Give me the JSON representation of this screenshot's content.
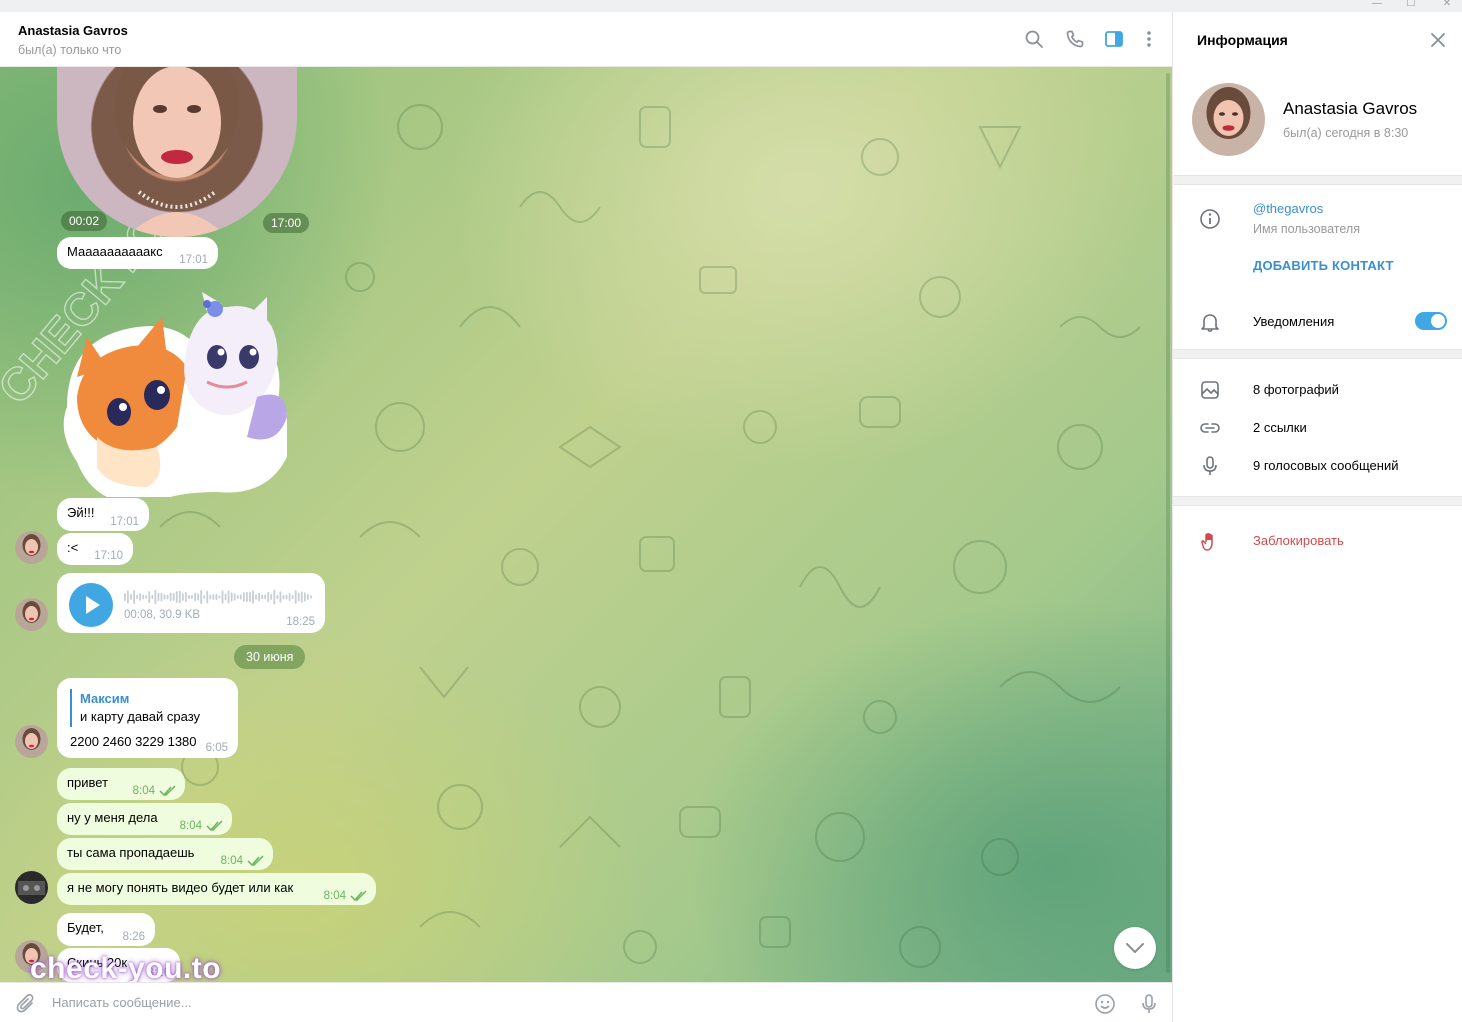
{
  "window": {
    "controls": [
      "—",
      "☐",
      "✕"
    ]
  },
  "header": {
    "peer_name": "Anastasia Gavros",
    "peer_status": "был(а) только что",
    "icons": [
      "search-icon",
      "phone-icon",
      "sidebar-toggle-icon",
      "more-vertical-icon"
    ]
  },
  "messages": {
    "video_note": {
      "duration": "00:02",
      "time": "17:00"
    },
    "msg1": {
      "text": "Маааааааааакс",
      "time": "17:01"
    },
    "msg2": {
      "text": "Эй!!!",
      "time": "17:01"
    },
    "msg3": {
      "text": ":<",
      "time": "17:10"
    },
    "voice": {
      "meta": "00:08, 30.9 KB",
      "time": "18:25",
      "progress": 0
    },
    "date_separator": "30 июня",
    "reply": {
      "author": "Максим",
      "quote": "и карту давай сразу",
      "text": "2200 2460 3229 1380",
      "time": "6:05"
    },
    "out1": {
      "text": "привет",
      "time": "8:04"
    },
    "out2": {
      "text": "ну у меня дела",
      "time": "8:04"
    },
    "out3": {
      "text": "ты сама пропадаешь",
      "time": "8:04"
    },
    "out4": {
      "text": "я не могу понять видео будет или как",
      "time": "8:04"
    },
    "msg4": {
      "text": "Будет,",
      "time": "8:26"
    },
    "msg5": {
      "text": "Скинь 20к",
      "time": "8:26"
    }
  },
  "watermarks": {
    "bottom": "check-you.to",
    "diagonal": "CHECKYOU.ME"
  },
  "composer": {
    "placeholder": "Написать сообщение..."
  },
  "info_panel": {
    "title": "Информация",
    "name": "Anastasia Gavros",
    "status": "был(а) сегодня в 8:30",
    "username": "@thegavros",
    "username_label": "Имя пользователя",
    "add_contact": "ДОБАВИТЬ КОНТАКТ",
    "notifications_label": "Уведомления",
    "notifications_on": true,
    "photos": "8 фотографий",
    "links": "2 ссылки",
    "voice_messages": "9 голосовых сообщений",
    "block": "Заблокировать"
  },
  "colors": {
    "accent": "#40a7e3",
    "outgoing_bubble": "#effdde",
    "danger": "#d14b4b"
  }
}
